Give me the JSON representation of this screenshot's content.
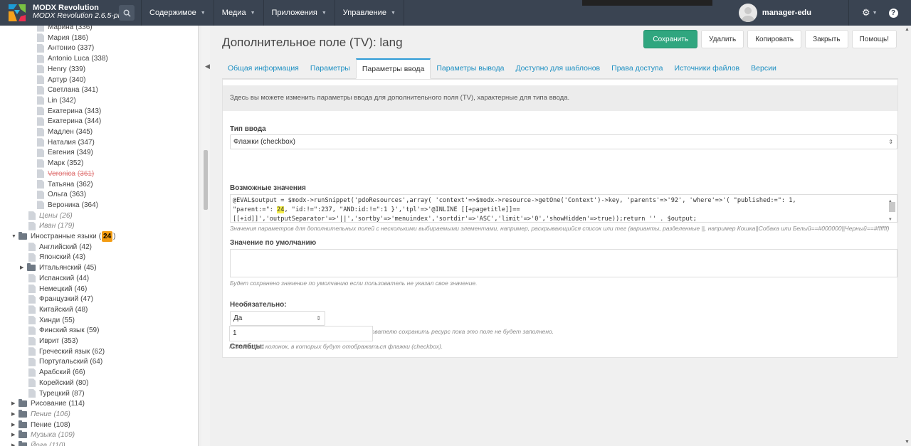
{
  "app": {
    "name": "MODX Revolution",
    "version": "MODX Revolution 2.6.5-pl"
  },
  "menu": [
    {
      "label": "Содержимое"
    },
    {
      "label": "Медиа"
    },
    {
      "label": "Приложения"
    },
    {
      "label": "Управление"
    }
  ],
  "user": {
    "name": "manager-edu"
  },
  "tree": {
    "items": [
      {
        "label": "Марина",
        "count": "(336)",
        "kind": "page",
        "indent": 3
      },
      {
        "label": "Мария",
        "count": "(186)",
        "kind": "page",
        "indent": 3
      },
      {
        "label": "Антонио",
        "count": "(337)",
        "kind": "page",
        "indent": 3
      },
      {
        "label": "Antonio Luca",
        "count": "(338)",
        "kind": "page",
        "indent": 3
      },
      {
        "label": "Henry",
        "count": "(339)",
        "kind": "page",
        "indent": 3
      },
      {
        "label": "Артур",
        "count": "(340)",
        "kind": "page",
        "indent": 3
      },
      {
        "label": "Светлана",
        "count": "(341)",
        "kind": "page",
        "indent": 3
      },
      {
        "label": "Lin",
        "count": "(342)",
        "kind": "page",
        "indent": 3
      },
      {
        "label": "Екатерина",
        "count": "(343)",
        "kind": "page",
        "indent": 3
      },
      {
        "label": "Екатерина",
        "count": "(344)",
        "kind": "page",
        "indent": 3
      },
      {
        "label": "Мадлен",
        "count": "(345)",
        "kind": "page",
        "indent": 3
      },
      {
        "label": "Наталия",
        "count": "(347)",
        "kind": "page",
        "indent": 3
      },
      {
        "label": "Евгения",
        "count": "(349)",
        "kind": "page",
        "indent": 3
      },
      {
        "label": "Марк",
        "count": "(352)",
        "kind": "page",
        "indent": 3
      },
      {
        "label": "Veronica",
        "count": "(361)",
        "kind": "page",
        "indent": 3,
        "state": "deleted"
      },
      {
        "label": "Татьяна",
        "count": "(362)",
        "kind": "page",
        "indent": 3
      },
      {
        "label": "Ольга",
        "count": "(363)",
        "kind": "page",
        "indent": 3
      },
      {
        "label": "Вероника",
        "count": "(364)",
        "kind": "page",
        "indent": 3
      },
      {
        "label": "Цены",
        "count": "(26)",
        "kind": "page",
        "indent": 2,
        "state": "unpub"
      },
      {
        "label": "Иван",
        "count": "(179)",
        "kind": "page",
        "indent": 2,
        "state": "unpub"
      },
      {
        "label": "Иностранные языки",
        "count": "24",
        "kind": "folder-open",
        "indent": 1
      },
      {
        "label": "Английский",
        "count": "(42)",
        "kind": "page",
        "indent": 2
      },
      {
        "label": "Японский",
        "count": "(43)",
        "kind": "page",
        "indent": 2
      },
      {
        "label": "Итальянский",
        "count": "(45)",
        "kind": "folder-closed",
        "indent": 2
      },
      {
        "label": "Испанский",
        "count": "(44)",
        "kind": "page",
        "indent": 2
      },
      {
        "label": "Немецкий",
        "count": "(46)",
        "kind": "page",
        "indent": 2
      },
      {
        "label": "Французкий",
        "count": "(47)",
        "kind": "page",
        "indent": 2
      },
      {
        "label": "Китайский",
        "count": "(48)",
        "kind": "page",
        "indent": 2
      },
      {
        "label": "Хинди",
        "count": "(55)",
        "kind": "page",
        "indent": 2
      },
      {
        "label": "Финский язык",
        "count": "(59)",
        "kind": "page",
        "indent": 2
      },
      {
        "label": "Иврит",
        "count": "(353)",
        "kind": "page",
        "indent": 2
      },
      {
        "label": "Греческий язык",
        "count": "(62)",
        "kind": "page",
        "indent": 2
      },
      {
        "label": "Португальский",
        "count": "(64)",
        "kind": "page",
        "indent": 2
      },
      {
        "label": "Арабский",
        "count": "(66)",
        "kind": "page",
        "indent": 2
      },
      {
        "label": "Корейский",
        "count": "(80)",
        "kind": "page",
        "indent": 2
      },
      {
        "label": "Турецкий",
        "count": "(87)",
        "kind": "page",
        "indent": 2
      },
      {
        "label": "Рисование",
        "count": "(114)",
        "kind": "folder-closed",
        "indent": 1
      },
      {
        "label": "Пение",
        "count": "(106)",
        "kind": "folder-closed",
        "indent": 1,
        "state": "unpub"
      },
      {
        "label": "Пение",
        "count": "(108)",
        "kind": "folder-closed",
        "indent": 1
      },
      {
        "label": "Музыка",
        "count": "(109)",
        "kind": "folder-closed",
        "indent": 1,
        "state": "unpub"
      },
      {
        "label": "Йога",
        "count": "(110)",
        "kind": "folder-closed",
        "indent": 1,
        "state": "unpub"
      }
    ]
  },
  "page": {
    "title": "Дополнительное поле (TV): lang",
    "buttons": {
      "save": "Сохранить",
      "delete": "Удалить",
      "copy": "Копировать",
      "close": "Закрыть",
      "help": "Помощь!"
    },
    "tabs": [
      {
        "label": "Общая информация"
      },
      {
        "label": "Параметры"
      },
      {
        "label": "Параметры ввода",
        "active": true
      },
      {
        "label": "Параметры вывода"
      },
      {
        "label": "Доступно для шаблонов"
      },
      {
        "label": "Права доступа"
      },
      {
        "label": "Источники файлов"
      },
      {
        "label": "Версии"
      }
    ]
  },
  "form": {
    "intro": "Здесь вы можете изменить параметры ввода для дополнительного поля (TV), характерные для типа ввода.",
    "input_type": {
      "label": "Тип ввода",
      "value": "Флажки (checkbox)"
    },
    "possible_values": {
      "label": "Возможные значения",
      "code_part1": "@EVAL$output = $modx->runSnippet('pdoResources',array(   'context'=>$modx->resource->getOne('Context')->key,   'parents'=>'92',   'where'=>'(       \"published:=\": 1,",
      "code_part2": "\"parent:=\": ",
      "code_highlight": "24",
      "code_part3": ",    \"id:!=\":237,    \"AND:id:!=\":1        }','tpl'=>'@INLINE [[+pagetitle]]==",
      "code_part4": "[[+id]]','outputSeparator'=>'||','sortby'=>'menuindex','sortdir'=>'ASC','limit'=>'0','showHidden'=>true));return '' . $output;",
      "help": "Значения параметров для дополнительных полей с несколькими выбираемыми элементами, например, раскрывающийся список или тег (варианты, разделенные ||, например Кошка||Собака или Белый==#000000||Черный==#ffffff)"
    },
    "default_value": {
      "label": "Значение по умолчанию",
      "value": "",
      "help": "Будет сохранено значение по умолчанию если пользователь не указал свое значение."
    },
    "optional": {
      "label": "Необязательно:",
      "value": "Да",
      "help": "Если выбрать «Нет», MODX не разрешит пользователю сохранить ресурс пока это поле не будет заполнено."
    },
    "columns": {
      "label": "Столбцы:",
      "value": "1",
      "help": "Количество колонок, в которых будут отображаться флажки (checkbox)."
    }
  }
}
